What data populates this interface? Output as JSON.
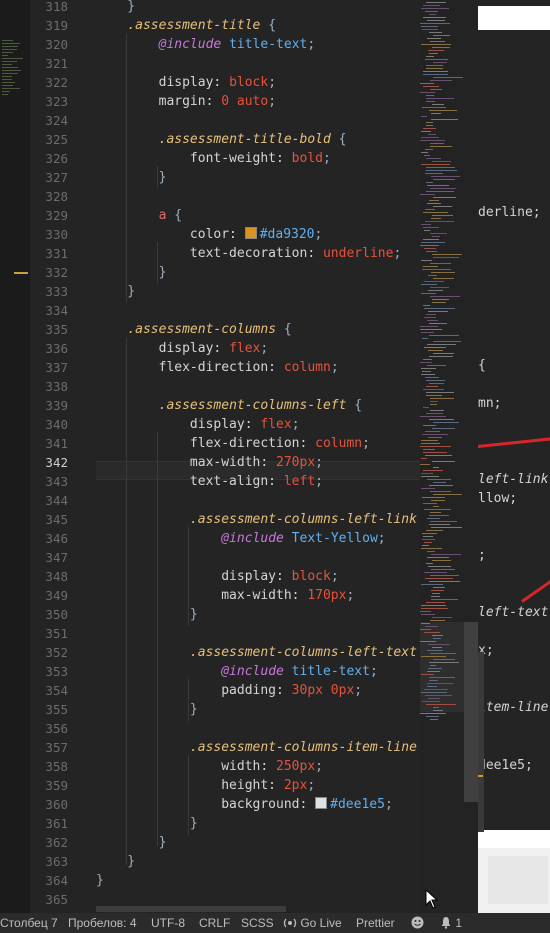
{
  "colors": {
    "selector": "#e6c07b",
    "at_rule": "#c678dd",
    "function": "#61afef",
    "value": "#e5533d",
    "swatch_gold": "#da9320",
    "swatch_light": "#dee1e5"
  },
  "lines": [
    {
      "n": "318",
      "active": false,
      "tokens": [
        {
          "t": "punc",
          "v": "    }"
        }
      ]
    },
    {
      "n": "319",
      "active": false,
      "tokens": [
        {
          "t": "punc",
          "v": "    "
        },
        {
          "t": "sel",
          "v": ".assessment-title"
        },
        {
          "t": "punc",
          "v": " {"
        }
      ]
    },
    {
      "n": "320",
      "active": false,
      "tokens": [
        {
          "t": "punc",
          "v": "        "
        },
        {
          "t": "at",
          "v": "@include"
        },
        {
          "t": "fn",
          "v": " title-text"
        },
        {
          "t": "punc",
          "v": ";"
        }
      ]
    },
    {
      "n": "321",
      "active": false,
      "tokens": []
    },
    {
      "n": "322",
      "active": false,
      "tokens": [
        {
          "t": "prop",
          "v": "        display: "
        },
        {
          "t": "val",
          "v": "block"
        },
        {
          "t": "punc",
          "v": ";"
        }
      ]
    },
    {
      "n": "323",
      "active": false,
      "tokens": [
        {
          "t": "prop",
          "v": "        margin: "
        },
        {
          "t": "num",
          "v": "0"
        },
        {
          "t": "val",
          "v": " auto"
        },
        {
          "t": "punc",
          "v": ";"
        }
      ]
    },
    {
      "n": "324",
      "active": false,
      "tokens": []
    },
    {
      "n": "325",
      "active": false,
      "tokens": [
        {
          "t": "punc",
          "v": "        "
        },
        {
          "t": "sel",
          "v": ".assessment-title-bold"
        },
        {
          "t": "punc",
          "v": " {"
        }
      ]
    },
    {
      "n": "326",
      "active": false,
      "tokens": [
        {
          "t": "prop",
          "v": "            font-weight: "
        },
        {
          "t": "val",
          "v": "bold"
        },
        {
          "t": "punc",
          "v": ";"
        }
      ]
    },
    {
      "n": "327",
      "active": false,
      "tokens": [
        {
          "t": "punc",
          "v": "        }"
        }
      ]
    },
    {
      "n": "328",
      "active": false,
      "tokens": []
    },
    {
      "n": "329",
      "active": false,
      "tokens": [
        {
          "t": "punc",
          "v": "        "
        },
        {
          "t": "tag",
          "v": "a"
        },
        {
          "t": "punc",
          "v": " {"
        }
      ]
    },
    {
      "n": "330",
      "active": false,
      "tokens": [
        {
          "t": "prop",
          "v": "            color: "
        },
        {
          "t": "swatch",
          "v": "#da9320"
        },
        {
          "t": "fn",
          "v": "#da9320"
        },
        {
          "t": "punc",
          "v": ";"
        }
      ]
    },
    {
      "n": "331",
      "active": false,
      "tokens": [
        {
          "t": "prop",
          "v": "            text-decoration: "
        },
        {
          "t": "val",
          "v": "underline"
        },
        {
          "t": "punc",
          "v": ";"
        }
      ]
    },
    {
      "n": "332",
      "active": false,
      "tokens": [
        {
          "t": "punc",
          "v": "        }"
        }
      ]
    },
    {
      "n": "333",
      "active": false,
      "tokens": [
        {
          "t": "punc",
          "v": "    }"
        }
      ]
    },
    {
      "n": "334",
      "active": false,
      "tokens": []
    },
    {
      "n": "335",
      "active": false,
      "tokens": [
        {
          "t": "punc",
          "v": "    "
        },
        {
          "t": "sel",
          "v": ".assessment-columns"
        },
        {
          "t": "punc",
          "v": " {"
        }
      ]
    },
    {
      "n": "336",
      "active": false,
      "tokens": [
        {
          "t": "prop",
          "v": "        display: "
        },
        {
          "t": "val",
          "v": "flex"
        },
        {
          "t": "punc",
          "v": ";"
        }
      ]
    },
    {
      "n": "337",
      "active": false,
      "tokens": [
        {
          "t": "prop",
          "v": "        flex-direction: "
        },
        {
          "t": "val",
          "v": "column"
        },
        {
          "t": "punc",
          "v": ";"
        }
      ]
    },
    {
      "n": "338",
      "active": false,
      "tokens": []
    },
    {
      "n": "339",
      "active": false,
      "tokens": [
        {
          "t": "punc",
          "v": "        "
        },
        {
          "t": "sel",
          "v": ".assessment-columns-left"
        },
        {
          "t": "punc",
          "v": " {"
        }
      ]
    },
    {
      "n": "340",
      "active": false,
      "tokens": [
        {
          "t": "prop",
          "v": "            display: "
        },
        {
          "t": "val",
          "v": "flex"
        },
        {
          "t": "punc",
          "v": ";"
        }
      ]
    },
    {
      "n": "341",
      "active": false,
      "tokens": [
        {
          "t": "prop",
          "v": "            flex-direction: "
        },
        {
          "t": "val",
          "v": "column"
        },
        {
          "t": "punc",
          "v": ";"
        }
      ]
    },
    {
      "n": "342",
      "active": true,
      "tokens": [
        {
          "t": "prop",
          "v": "            max-width: "
        },
        {
          "t": "num",
          "v": "270px"
        },
        {
          "t": "punc",
          "v": ";"
        }
      ]
    },
    {
      "n": "343",
      "active": false,
      "tokens": [
        {
          "t": "prop",
          "v": "            text-align: "
        },
        {
          "t": "val",
          "v": "left"
        },
        {
          "t": "punc",
          "v": ";"
        }
      ]
    },
    {
      "n": "344",
      "active": false,
      "tokens": []
    },
    {
      "n": "345",
      "active": false,
      "tokens": [
        {
          "t": "punc",
          "v": "            "
        },
        {
          "t": "sel",
          "v": ".assessment-columns-left-link"
        },
        {
          "t": "punc",
          "v": " {"
        }
      ]
    },
    {
      "n": "346",
      "active": false,
      "tokens": [
        {
          "t": "punc",
          "v": "                "
        },
        {
          "t": "at",
          "v": "@include"
        },
        {
          "t": "fn",
          "v": " Text-Yellow"
        },
        {
          "t": "punc",
          "v": ";"
        }
      ]
    },
    {
      "n": "347",
      "active": false,
      "tokens": []
    },
    {
      "n": "348",
      "active": false,
      "tokens": [
        {
          "t": "prop",
          "v": "                display: "
        },
        {
          "t": "val",
          "v": "block"
        },
        {
          "t": "punc",
          "v": ";"
        }
      ]
    },
    {
      "n": "349",
      "active": false,
      "tokens": [
        {
          "t": "prop",
          "v": "                max-width: "
        },
        {
          "t": "num",
          "v": "170px"
        },
        {
          "t": "punc",
          "v": ";"
        }
      ]
    },
    {
      "n": "350",
      "active": false,
      "tokens": [
        {
          "t": "punc",
          "v": "            }"
        }
      ]
    },
    {
      "n": "351",
      "active": false,
      "tokens": []
    },
    {
      "n": "352",
      "active": false,
      "tokens": [
        {
          "t": "punc",
          "v": "            "
        },
        {
          "t": "sel",
          "v": ".assessment-columns-left-text"
        },
        {
          "t": "punc",
          "v": " {"
        }
      ]
    },
    {
      "n": "353",
      "active": false,
      "tokens": [
        {
          "t": "punc",
          "v": "                "
        },
        {
          "t": "at",
          "v": "@include"
        },
        {
          "t": "fn",
          "v": " title-text"
        },
        {
          "t": "punc",
          "v": ";"
        }
      ]
    },
    {
      "n": "354",
      "active": false,
      "tokens": [
        {
          "t": "prop",
          "v": "                padding: "
        },
        {
          "t": "num",
          "v": "30px 0px"
        },
        {
          "t": "punc",
          "v": ";"
        }
      ]
    },
    {
      "n": "355",
      "active": false,
      "tokens": [
        {
          "t": "punc",
          "v": "            }"
        }
      ]
    },
    {
      "n": "356",
      "active": false,
      "tokens": []
    },
    {
      "n": "357",
      "active": false,
      "tokens": [
        {
          "t": "punc",
          "v": "            "
        },
        {
          "t": "sel",
          "v": ".assessment-columns-item-line"
        },
        {
          "t": "punc",
          "v": " {"
        }
      ]
    },
    {
      "n": "358",
      "active": false,
      "tokens": [
        {
          "t": "prop",
          "v": "                width: "
        },
        {
          "t": "num",
          "v": "250px"
        },
        {
          "t": "punc",
          "v": ";"
        }
      ]
    },
    {
      "n": "359",
      "active": false,
      "tokens": [
        {
          "t": "prop",
          "v": "                height: "
        },
        {
          "t": "num",
          "v": "2px"
        },
        {
          "t": "punc",
          "v": ";"
        }
      ]
    },
    {
      "n": "360",
      "active": false,
      "tokens": [
        {
          "t": "prop",
          "v": "                background: "
        },
        {
          "t": "swatch",
          "v": "#dee1e5"
        },
        {
          "t": "fn",
          "v": "#dee1e5"
        },
        {
          "t": "punc",
          "v": ";"
        }
      ]
    },
    {
      "n": "361",
      "active": false,
      "tokens": [
        {
          "t": "punc",
          "v": "            }"
        }
      ]
    },
    {
      "n": "362",
      "active": false,
      "tokens": [
        {
          "t": "punc",
          "v": "        }"
        }
      ]
    },
    {
      "n": "363",
      "active": false,
      "tokens": [
        {
          "t": "punc",
          "v": "    }"
        }
      ]
    },
    {
      "n": "364",
      "active": false,
      "tokens": [
        {
          "t": "punc",
          "v": "}"
        }
      ]
    },
    {
      "n": "365",
      "active": false,
      "tokens": []
    }
  ],
  "background_window": {
    "fragments": [
      "derline;",
      "{",
      "mn;",
      "left-link",
      "llow;",
      ";",
      "left-text",
      "x;",
      "item-line",
      "dee1e5;"
    ]
  },
  "statusbar": {
    "position": "Столбец 7",
    "spaces": "Пробелов: 4",
    "encoding": "UTF-8",
    "eol": "CRLF",
    "language": "SCSS",
    "golive": "Go Live",
    "formatter": "Prettier",
    "notifications": "1"
  }
}
